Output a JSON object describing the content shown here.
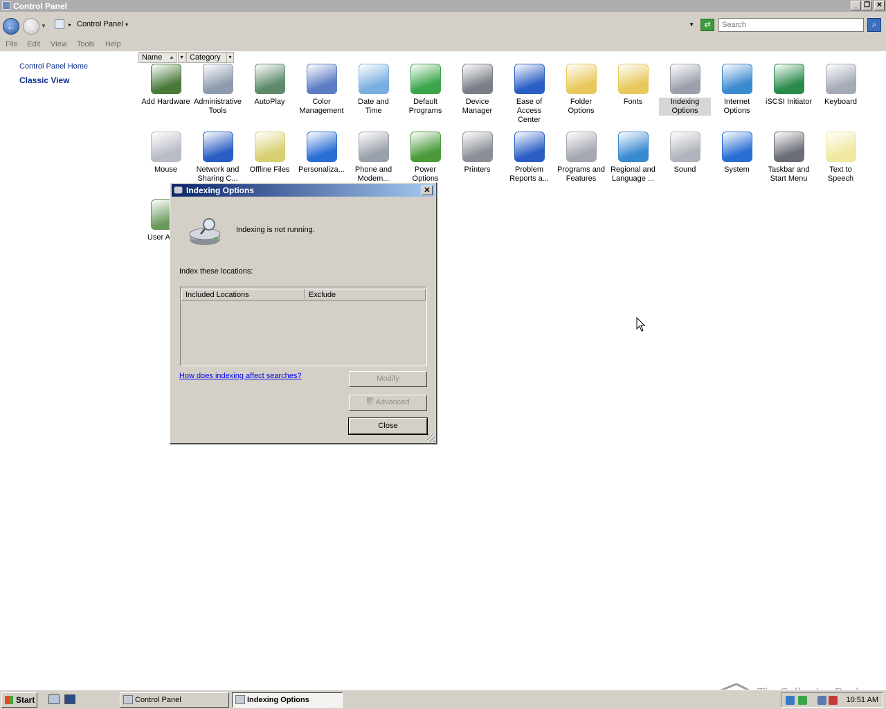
{
  "window": {
    "title": "Control Panel",
    "minimize": "_",
    "restore": "❐",
    "close": "✕"
  },
  "address_bar": {
    "breadcrumb": "Control Panel",
    "search_placeholder": "Search"
  },
  "menu": [
    "File",
    "Edit",
    "View",
    "Tools",
    "Help"
  ],
  "left_pane": {
    "home_link": "Control Panel Home",
    "classic_view": "Classic View"
  },
  "columns": {
    "name": "Name",
    "category": "Category"
  },
  "icons": [
    {
      "label": "Add Hardware",
      "icon": "add-hardware-icon",
      "color": "#4a7a3a"
    },
    {
      "label": "Administrative Tools",
      "icon": "administrative-tools-icon",
      "color": "#8e9aae"
    },
    {
      "label": "AutoPlay",
      "icon": "autoplay-icon",
      "color": "#5c8a6a"
    },
    {
      "label": "Color Management",
      "icon": "color-management-icon",
      "color": "#5b7bc4"
    },
    {
      "label": "Date and Time",
      "icon": "date-and-time-icon",
      "color": "#7aaee0"
    },
    {
      "label": "Default Programs",
      "icon": "default-programs-icon",
      "color": "#3aa54a"
    },
    {
      "label": "Device Manager",
      "icon": "device-manager-icon",
      "color": "#7a7e86"
    },
    {
      "label": "Ease of Access Center",
      "icon": "ease-of-access-icon",
      "color": "#2a5ec4"
    },
    {
      "label": "Folder Options",
      "icon": "folder-options-icon",
      "color": "#e8c85c"
    },
    {
      "label": "Fonts",
      "icon": "fonts-icon",
      "color": "#e8c85c"
    },
    {
      "label": "Indexing Options",
      "icon": "indexing-options-icon",
      "color": "#9aa0ac"
    },
    {
      "label": "Internet Options",
      "icon": "internet-options-icon",
      "color": "#3a8ad0"
    },
    {
      "label": "iSCSI Initiator",
      "icon": "iscsi-initiator-icon",
      "color": "#2a8a4a"
    },
    {
      "label": "Keyboard",
      "icon": "keyboard-icon",
      "color": "#a4aab6"
    },
    {
      "label": "Mouse",
      "icon": "mouse-icon",
      "color": "#b8bcc4"
    },
    {
      "label": "Network and Sharing C...",
      "icon": "network-sharing-icon",
      "color": "#2a5ec4"
    },
    {
      "label": "Offline Files",
      "icon": "offline-files-icon",
      "color": "#d8d070"
    },
    {
      "label": "Personaliza...",
      "icon": "personalization-icon",
      "color": "#2a6ed4"
    },
    {
      "label": "Phone and Modem...",
      "icon": "phone-modem-icon",
      "color": "#9aa0ac"
    },
    {
      "label": "Power Options",
      "icon": "power-options-icon",
      "color": "#4a9a3a"
    },
    {
      "label": "Printers",
      "icon": "printers-icon",
      "color": "#8a8e96"
    },
    {
      "label": "Problem Reports a...",
      "icon": "problem-reports-icon",
      "color": "#2a5ec4"
    },
    {
      "label": "Programs and Features",
      "icon": "programs-features-icon",
      "color": "#a4a8b0"
    },
    {
      "label": "Regional and Language ...",
      "icon": "regional-language-icon",
      "color": "#3a8ad0"
    },
    {
      "label": "Sound",
      "icon": "sound-icon",
      "color": "#b0b4bc"
    },
    {
      "label": "System",
      "icon": "system-icon",
      "color": "#2a6ed4"
    },
    {
      "label": "Taskbar and Start Menu",
      "icon": "taskbar-start-menu-icon",
      "color": "#6a6e76"
    },
    {
      "label": "Text to Speech",
      "icon": "text-to-speech-icon",
      "color": "#f0e8a0"
    },
    {
      "label": "User Acc...",
      "icon": "user-accounts-icon",
      "color": "#6a9a5a"
    }
  ],
  "selected_icon": "Indexing Options",
  "dialog": {
    "title": "Indexing Options",
    "close": "✕",
    "status": "Indexing is not running.",
    "locations_label": "Index these locations:",
    "col_included": "Included Locations",
    "col_exclude": "Exclude",
    "help_link": "How does indexing affect searches?",
    "modify": "Modify",
    "advanced": "Advanced",
    "close_button": "Close"
  },
  "taskbar": {
    "start": "Start",
    "tasks": [
      "Control Panel",
      "Indexing Options"
    ],
    "clock": "10:51 AM"
  },
  "watermark": "The Collection Book"
}
